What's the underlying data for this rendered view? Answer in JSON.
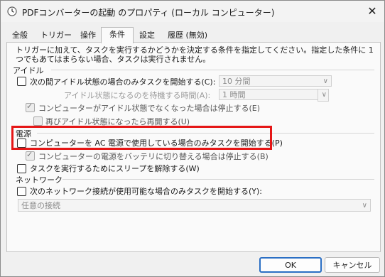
{
  "window": {
    "title": "PDFコンバーターの起動 のプロパティ (ローカル コンピューター)",
    "close_glyph": "✕"
  },
  "tabs": [
    {
      "label": "全般"
    },
    {
      "label": "トリガー"
    },
    {
      "label": "操作"
    },
    {
      "label": "条件"
    },
    {
      "label": "設定"
    },
    {
      "label": "履歴 (無効)"
    }
  ],
  "description": "トリガーに加えて、タスクを実行するかどうかを決定する条件を指定してください。指定した条件に 1 つでもあてはまらない場合、タスクは実行されません。",
  "idle": {
    "section": "アイドル",
    "start_only_idle": "次の間アイドル状態の場合のみタスクを開始する(C):",
    "idle_duration_value": "10 分間",
    "wait_label": "アイドル状態になるのを待機する時間(A):",
    "wait_value": "1 時間",
    "stop_on_not_idle": "コンピューターがアイドル状態でなくなった場合は停止する(E)",
    "restart_on_idle": "再びアイドル状態になったら再開する(U)"
  },
  "power": {
    "section": "電源",
    "ac_only": "コンピューターを AC 電源で使用している場合のみタスクを開始する(P)",
    "stop_on_battery": "コンピューターの電源をバッテリに切り替える場合は停止する(B)",
    "wake": "タスクを実行するためにスリープを解除する(W)"
  },
  "network": {
    "section": "ネットワーク",
    "only_if_available": "次のネットワーク接続が使用可能な場合のみタスクを開始する(Y):",
    "connection_value": "任意の接続"
  },
  "buttons": {
    "ok": "OK",
    "cancel": "キャンセル"
  },
  "colors": {
    "highlight": "#e51616",
    "primary_border": "#2b6fc4"
  },
  "icons": {
    "app": "scheduled-task-clock-icon",
    "chevron": "chevron-down-icon",
    "check": "checkmark-icon"
  }
}
